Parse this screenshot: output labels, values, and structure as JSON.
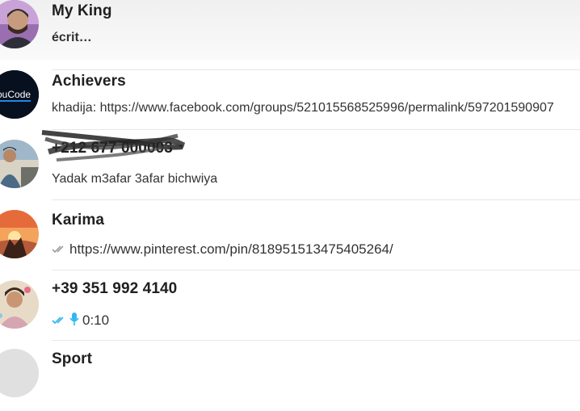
{
  "chats": [
    {
      "name": "My King",
      "preview": "écrit…"
    },
    {
      "name": "Achievers",
      "avatar_text": "ouCode",
      "preview": "khadija: https://www.facebook.com/groups/521015568525996/permalink/597201590907"
    },
    {
      "name": "+212 677 000003",
      "preview": "Yadak m3afar 3afar bichwiya"
    },
    {
      "name": "Karima",
      "preview": "https://www.pinterest.com/pin/818951513475405264/",
      "ticks": "read-grey"
    },
    {
      "name": "+39 351 992 4140",
      "preview": "0:10",
      "ticks": "read-blue",
      "icon": "mic-icon"
    },
    {
      "name": "Sport"
    }
  ],
  "colors": {
    "tick_grey": "#9e9e9e",
    "tick_blue": "#34b7f1",
    "mic_blue": "#34b7f1",
    "brand_blue": "#1e88e5"
  }
}
